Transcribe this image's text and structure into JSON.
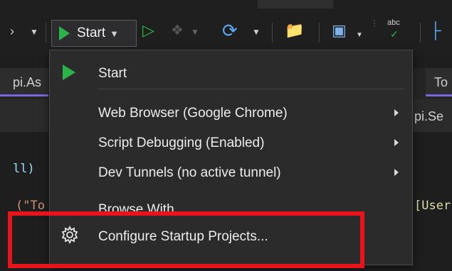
{
  "toolbar": {
    "start_label": "Start",
    "abc_label": "abc"
  },
  "tabs": {
    "left_tab": "pi.As",
    "right_tab": "To",
    "second_right": "pi.Se"
  },
  "code": {
    "line1": "ll)",
    "line2": "(\"To",
    "line2_right": "[User"
  },
  "menu": {
    "items": [
      {
        "label": "Start",
        "icon": "play-icon"
      },
      {
        "label": "Web Browser (Google Chrome)",
        "has_submenu": true
      },
      {
        "label": "Script Debugging (Enabled)",
        "has_submenu": true
      },
      {
        "label": "Dev Tunnels (no active tunnel)",
        "has_submenu": true
      },
      {
        "label": "Browse With..."
      },
      {
        "label": "Configure Startup Projects...",
        "icon": "gear-icon"
      }
    ]
  },
  "colors": {
    "accent_green": "#2bb34a",
    "highlight_red": "#e8141b",
    "menu_bg": "#2b2b2b"
  }
}
